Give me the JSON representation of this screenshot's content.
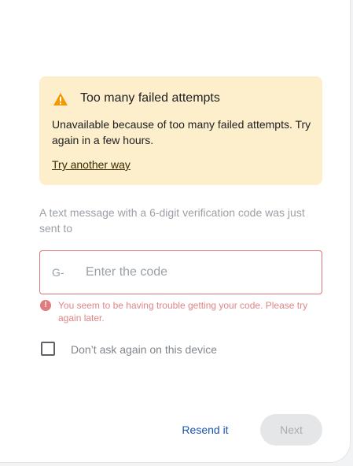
{
  "alert": {
    "icon": "warning-icon",
    "title": "Too many failed attempts",
    "body": "Unavailable because of too many failed attempts. Try again in a few hours.",
    "link_label": "Try another way",
    "background_color": "#feefcc",
    "icon_color": "#f29900"
  },
  "info_text": "A text message with a 6-digit verification code was just sent to",
  "code_field": {
    "prefix": "G-",
    "value": "",
    "placeholder": "Enter the code",
    "border_color": "#d9777a"
  },
  "error": {
    "icon": "error-icon",
    "message": "You seem to be having trouble getting your code. Please try again later.",
    "color": "#e08587"
  },
  "remember_device": {
    "label": "Don’t ask again on this device",
    "checked": false
  },
  "actions": {
    "resend_label": "Resend it",
    "next_label": "Next",
    "link_color": "#1a57b3"
  }
}
